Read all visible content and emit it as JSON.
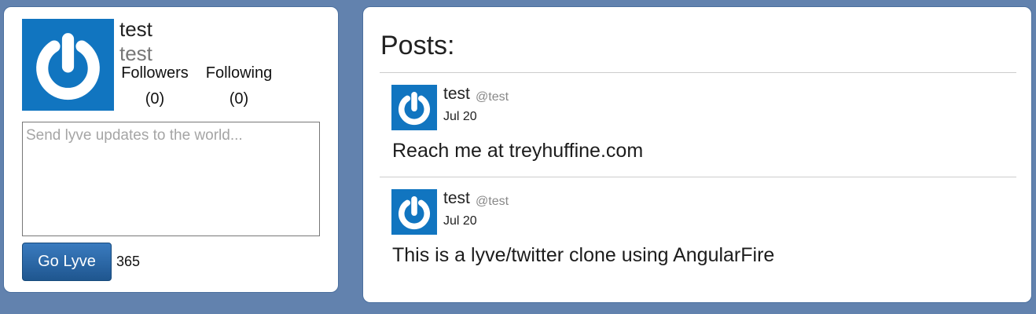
{
  "profile": {
    "name": "test",
    "handle": "test",
    "followers_label": "Followers",
    "followers_count": "(0)",
    "following_label": "Following",
    "following_count": "(0)",
    "avatar_icon": "power-logo-icon"
  },
  "composer": {
    "placeholder": "Send lyve updates to the world...",
    "value": "",
    "submit_label": "Go Lyve",
    "char_count": "365"
  },
  "feed": {
    "title": "Posts:",
    "posts": [
      {
        "name": "test",
        "handle": "@test",
        "date": "Jul 20",
        "body": "Reach me at treyhuffine.com",
        "avatar_icon": "power-logo-icon"
      },
      {
        "name": "test",
        "handle": "@test",
        "date": "Jul 20",
        "body": "This is a lyve/twitter clone using AngularFire",
        "avatar_icon": "power-logo-icon"
      }
    ]
  },
  "colors": {
    "page_background": "#6282ae",
    "avatar_blue": "#1175c0",
    "button_blue": "#2a6aa8"
  }
}
